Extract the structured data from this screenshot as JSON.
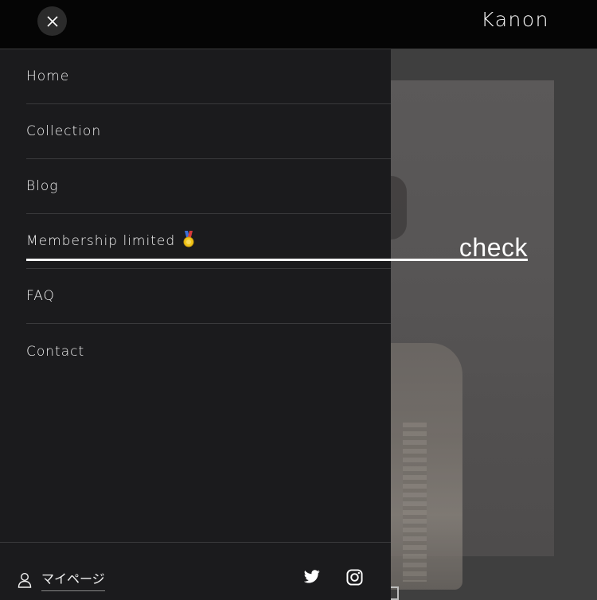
{
  "header": {
    "brand": "Kanon",
    "close_icon": "close-icon"
  },
  "nav": {
    "items": [
      {
        "label": "Home"
      },
      {
        "label": "Collection"
      },
      {
        "label": "Blog"
      },
      {
        "label": "Membership limited",
        "icon": "medal-icon"
      },
      {
        "label": "FAQ"
      },
      {
        "label": "Contact"
      }
    ]
  },
  "overlay": {
    "check_label": "check"
  },
  "footer": {
    "mypage_label": "マイページ",
    "mypage_icon": "user-icon",
    "social": [
      "twitter-icon",
      "instagram-icon"
    ]
  },
  "colors": {
    "header_bg": "#050505",
    "drawer_bg": "#1b1b1d",
    "divider": "#3a3a3c",
    "text": "#f2f2f2",
    "backdrop": "#3f3f3f"
  }
}
